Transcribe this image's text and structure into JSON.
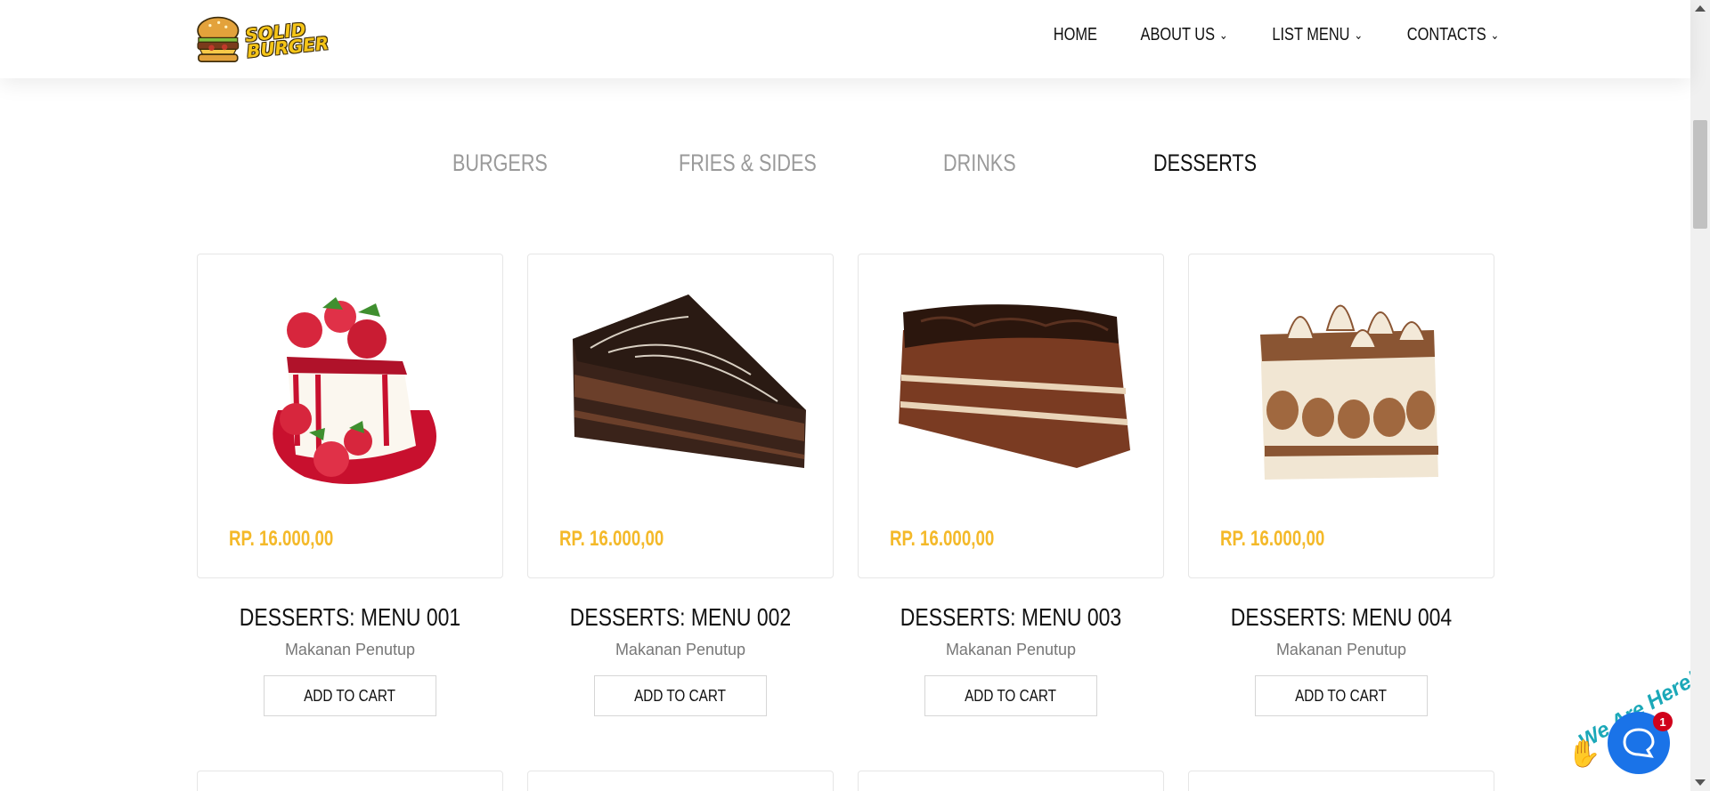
{
  "brand": {
    "name_line1": "SOLID",
    "name_line2": "BURGER"
  },
  "nav": {
    "items": [
      {
        "label": "HOME",
        "dropdown": false
      },
      {
        "label": "ABOUT US",
        "dropdown": true
      },
      {
        "label": "LIST MENU",
        "dropdown": true
      },
      {
        "label": "CONTACTS",
        "dropdown": true
      }
    ]
  },
  "tabs": [
    {
      "label": "BURGERS",
      "active": false
    },
    {
      "label": "FRIES & SIDES",
      "active": false
    },
    {
      "label": "DRINKS",
      "active": false
    },
    {
      "label": "DESSERTS",
      "active": true
    }
  ],
  "products": [
    {
      "title": "DESSERTS: MENU 001",
      "subtitle": "Makanan Penutup",
      "price": "RP. 16.000,00",
      "button": "ADD TO CART",
      "image": "strawberry-cheesecake"
    },
    {
      "title": "DESSERTS: MENU 002",
      "subtitle": "Makanan Penutup",
      "price": "RP. 16.000,00",
      "button": "ADD TO CART",
      "image": "chocolate-cake-slice"
    },
    {
      "title": "DESSERTS: MENU 003",
      "subtitle": "Makanan Penutup",
      "price": "RP. 16.000,00",
      "button": "ADD TO CART",
      "image": "chocolate-brownie-cake"
    },
    {
      "title": "DESSERTS: MENU 004",
      "subtitle": "Makanan Penutup",
      "price": "RP. 16.000,00",
      "button": "ADD TO CART",
      "image": "tiramisu"
    }
  ],
  "chat": {
    "label": "We Are Here!",
    "badge_count": "1"
  },
  "colors": {
    "price": "#f4b929",
    "tab_inactive": "#9a9a9a",
    "chat_blue": "#1a73e8",
    "brand_yellow": "#f5c518"
  }
}
